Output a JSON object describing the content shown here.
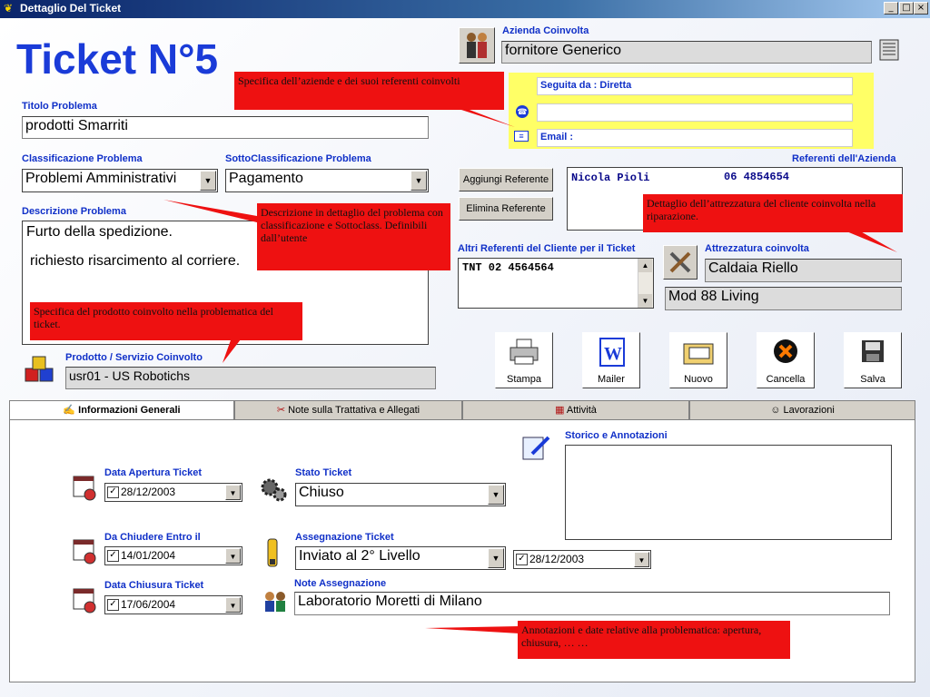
{
  "window": {
    "title": "Dettaglio Del Ticket",
    "controls": [
      "_",
      "□",
      "×"
    ]
  },
  "header": {
    "title": "Ticket N°5"
  },
  "azienda": {
    "label": "Azienda Coinvolta",
    "value": "fornitore Generico"
  },
  "seguita": {
    "label": "Seguita da : Diretta",
    "phone_value": "",
    "email_label": "Email :"
  },
  "titolo": {
    "label": "Titolo Problema",
    "value": "prodotti Smarriti"
  },
  "classificazione": {
    "label": "Classificazione Problema",
    "value": "Problemi Amministrativi"
  },
  "sottoclassificazione": {
    "label": "SottoClassificazione Problema",
    "value": "Pagamento"
  },
  "descrizione": {
    "label": "Descrizione Problema",
    "line1": "Furto della spedizione.",
    "line2": "richiesto risarcimento al corriere."
  },
  "referenti": {
    "label": "Referenti dell'Azienda",
    "add_button": "Aggiungi Referente",
    "remove_button": "Elimina Referente",
    "rows": [
      {
        "name": "Nicola Pioli",
        "phone": "06 4854654"
      }
    ]
  },
  "altri_referenti": {
    "label": "Altri Referenti del Cliente per il Ticket",
    "value": "TNT 02 4564564"
  },
  "attrezzatura": {
    "label": "Attrezzatura coinvolta",
    "value1": "Caldaia Riello",
    "value2": "Mod 88 Living"
  },
  "prodotto": {
    "label": "Prodotto / Servizio Coinvolto",
    "value": "usr01 - US Robotichs"
  },
  "toolbar": {
    "stampa": "Stampa",
    "mailer": "Mailer",
    "nuovo": "Nuovo",
    "cancella": "Cancella",
    "salva": "Salva"
  },
  "tabs": [
    {
      "label": "Informazioni Generali",
      "active": true
    },
    {
      "label": "Note sulla Trattativa e Allegati",
      "active": false
    },
    {
      "label": "Attività",
      "active": false
    },
    {
      "label": "Lavorazioni",
      "active": false
    }
  ],
  "info": {
    "data_apertura": {
      "label": "Data Apertura Ticket",
      "value": "28/12/2003",
      "checked": true
    },
    "da_chiudere": {
      "label": "Da Chiudere Entro il",
      "value": "14/01/2004",
      "checked": true
    },
    "data_chiusura": {
      "label": "Data Chiusura Ticket",
      "value": "17/06/2004",
      "checked": true
    },
    "stato": {
      "label": "Stato Ticket",
      "value": "Chiuso"
    },
    "assegnazione": {
      "label": "Assegnazione Ticket",
      "value": "Inviato al 2° Livello",
      "date": "28/12/2003",
      "checked": true
    },
    "note_assegnazione": {
      "label": "Note Assegnazione",
      "value": "Laboratorio Moretti di Milano"
    },
    "storico": {
      "label": "Storico e Annotazioni",
      "value": ""
    }
  },
  "callouts": {
    "azienda": "Specifica dell’aziende e dei  suoi referenti coinvolti",
    "descrizione": "Descrizione in dettaglio del problema con classificazione e Sottoclass. Definibili dall’utente",
    "prodotto": "Specifica del prodotto coinvolto nella problematica del ticket.",
    "attrezzatura": "Dettaglio dell’attrezzatura del cliente coinvolta nella riparazione.",
    "annotazioni": "Annotazioni e date relative alla problematica: apertura, chiusura, … …"
  },
  "colors": {
    "label_blue": "#1030c8",
    "title_blue": "#1a3bd8",
    "callout_red": "#ee1111",
    "highlight_yellow": "#ffff66"
  }
}
